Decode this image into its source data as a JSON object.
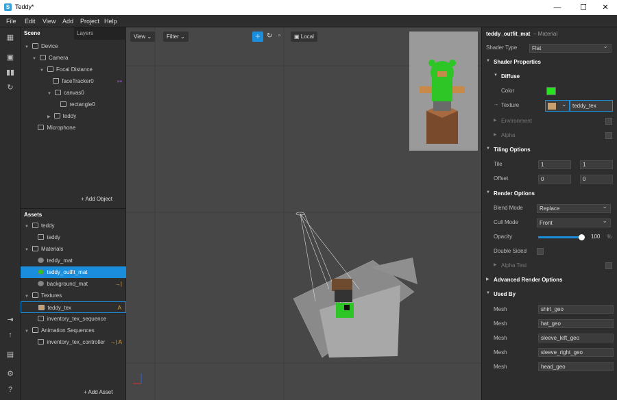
{
  "window": {
    "title": "Teddy*",
    "logo": "S",
    "controls": [
      "minimize-icon",
      "maximize-icon",
      "close-icon"
    ]
  },
  "menu": [
    "File",
    "Edit",
    "View",
    "Add",
    "Project",
    "Help"
  ],
  "toolstrip": [
    "layout-icon",
    "camera-icon",
    "split-icon",
    "sync-icon",
    "export-icon",
    "upload-icon",
    "folder-icon",
    "bug-icon",
    "help-icon"
  ],
  "scene": {
    "tabs": [
      "Scene",
      "Layers"
    ],
    "items": [
      {
        "label": "Device",
        "indent": 0,
        "arrow": "▼",
        "icon": "phone-icon"
      },
      {
        "label": "Camera",
        "indent": 1,
        "arrow": "▼",
        "icon": "camera-icon"
      },
      {
        "label": "Focal Distance",
        "indent": 2,
        "arrow": "▼",
        "icon": "focal-icon"
      },
      {
        "label": "faceTracker0",
        "indent": 3,
        "arrow": "",
        "icon": "face-tracker-icon"
      },
      {
        "label": "canvas0",
        "indent": 3,
        "arrow": "▼",
        "icon": "canvas-icon"
      },
      {
        "label": "rectangle0",
        "indent": 4,
        "arrow": "",
        "icon": "rectangle-icon"
      },
      {
        "label": "teddy",
        "indent": 3,
        "arrow": "▶",
        "icon": "mesh-icon"
      },
      {
        "label": "Microphone",
        "indent": 1,
        "arrow": "",
        "icon": "microphone-icon"
      }
    ],
    "add_label": "+ Add Object"
  },
  "assets": {
    "title": "Assets",
    "items": [
      {
        "label": "teddy",
        "indent": 0,
        "arrow": "▼",
        "icon": "file-icon"
      },
      {
        "label": "teddy",
        "indent": 1,
        "arrow": "",
        "icon": "mesh-icon"
      },
      {
        "label": "Materials",
        "indent": 0,
        "arrow": "▼",
        "icon": "folder-icon"
      },
      {
        "label": "teddy_mat",
        "indent": 1,
        "arrow": "",
        "icon": "material-icon"
      },
      {
        "label": "teddy_outfit_mat",
        "indent": 1,
        "arrow": "",
        "icon": "material-icon",
        "selected": true
      },
      {
        "label": "background_mat",
        "indent": 1,
        "arrow": "",
        "icon": "material-icon",
        "badge": "→|"
      },
      {
        "label": "Textures",
        "indent": 0,
        "arrow": "▼",
        "icon": "folder-icon"
      },
      {
        "label": "teddy_tex",
        "indent": 1,
        "arrow": "",
        "icon": "texture-icon",
        "badge": "A",
        "outlined": true
      },
      {
        "label": "inventory_tex_sequence",
        "indent": 1,
        "arrow": "",
        "icon": "sequence-icon"
      },
      {
        "label": "Animation Sequences",
        "indent": 0,
        "arrow": "▼",
        "icon": "folder-icon"
      },
      {
        "label": "inventory_tex_controller",
        "indent": 1,
        "arrow": "",
        "icon": "controller-icon",
        "badge": "→| A"
      }
    ],
    "add_label": "+ Add Asset"
  },
  "viewport": {
    "view_label": "View",
    "filter_label": "Filter",
    "local_label": "Local"
  },
  "inspector": {
    "title": "teddy_outfit_mat",
    "subtitle": "– Material",
    "shader_type_label": "Shader Type",
    "shader_type_value": "Flat",
    "shader_props": "Shader Properties",
    "diffuse": "Diffuse",
    "color_label": "Color",
    "color_value": "#27e31e",
    "texture_label": "Texture",
    "texture_value": "teddy_tex",
    "environment": "Environment",
    "alpha": "Alpha",
    "tiling": "Tiling Options",
    "tile_label": "Tile",
    "tile_x": "1",
    "tile_y": "1",
    "offset_label": "Offset",
    "offset_x": "0",
    "offset_y": "0",
    "render": "Render Options",
    "blend_label": "Blend Mode",
    "blend_value": "Replace",
    "cull_label": "Cull Mode",
    "cull_value": "Front",
    "opacity_label": "Opacity",
    "opacity_value": "100",
    "opacity_unit": "%",
    "opacity_fraction": 1.0,
    "double_sided": "Double Sided",
    "alpha_test": "Alpha Test",
    "advanced": "Advanced Render Options",
    "used_by": "Used By",
    "meshes": [
      {
        "label": "Mesh",
        "value": "shirt_geo"
      },
      {
        "label": "Mesh",
        "value": "hat_geo"
      },
      {
        "label": "Mesh",
        "value": "sleeve_left_geo"
      },
      {
        "label": "Mesh",
        "value": "sleeve_right_geo"
      },
      {
        "label": "Mesh",
        "value": "head_geo"
      }
    ]
  }
}
